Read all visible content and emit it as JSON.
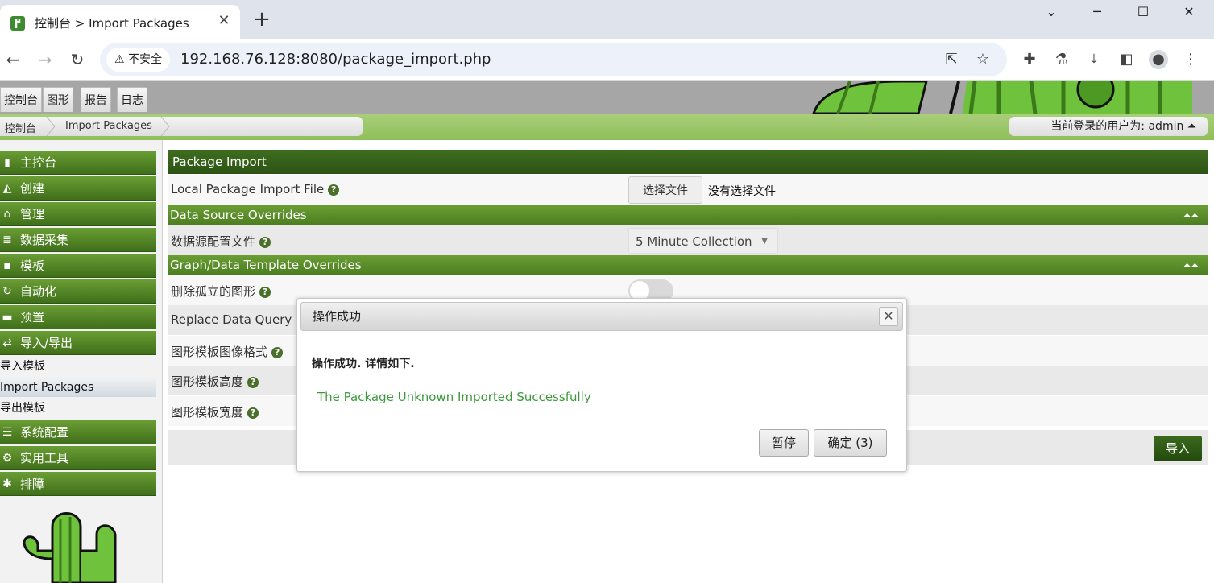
{
  "browser": {
    "tab_title": "控制台 > Import Packages",
    "security_label": "不安全",
    "url": "192.168.76.128:8080/package_import.php"
  },
  "cacti": {
    "main_tabs": [
      "控制台",
      "图形",
      "报告",
      "日志"
    ],
    "breadcrumbs": [
      "控制台",
      "Import Packages"
    ],
    "user_label": "当前登录的用户为: admin ⏶"
  },
  "sidebar": {
    "items": [
      {
        "label": "主控台",
        "icon": "map-icon"
      },
      {
        "label": "创建",
        "icon": "chart-icon"
      },
      {
        "label": "管理",
        "icon": "home-icon"
      },
      {
        "label": "数据采集",
        "icon": "database-icon"
      },
      {
        "label": "模板",
        "icon": "template-icon"
      },
      {
        "label": "自动化",
        "icon": "refresh-icon"
      },
      {
        "label": "预置",
        "icon": "preset-icon"
      },
      {
        "label": "导入/导出",
        "icon": "exchange-icon"
      }
    ],
    "subitems": [
      "导入模板",
      "Import Packages",
      "导出模板"
    ],
    "items2": [
      {
        "label": "系统配置",
        "icon": "sliders-icon"
      },
      {
        "label": "实用工具",
        "icon": "cogs-icon"
      },
      {
        "label": "排障",
        "icon": "debug-icon"
      }
    ]
  },
  "form": {
    "panel_title": "Package Import",
    "local_file_label": "Local Package Import File",
    "file_button": "选择文件",
    "file_status": "没有选择文件",
    "ds_overrides_header": "Data Source Overrides",
    "ds_profile_label": "数据源配置文件",
    "ds_profile_value": "5 Minute Collection",
    "graph_overrides_header": "Graph/Data Template Overrides",
    "remove_orphans_label": "删除孤立的图形",
    "replace_dq_label": "Replace Data Query S",
    "image_format_label": "图形模板图像格式",
    "height_label": "图形模板高度",
    "width_label": "图形模板宽度",
    "import_button": "导入"
  },
  "dialog": {
    "title": "操作成功",
    "message": "操作成功. 详情如下.",
    "result": "The Package Unknown Imported Successfully",
    "pause_button": "暂停",
    "ok_button": "确定 (3)"
  }
}
